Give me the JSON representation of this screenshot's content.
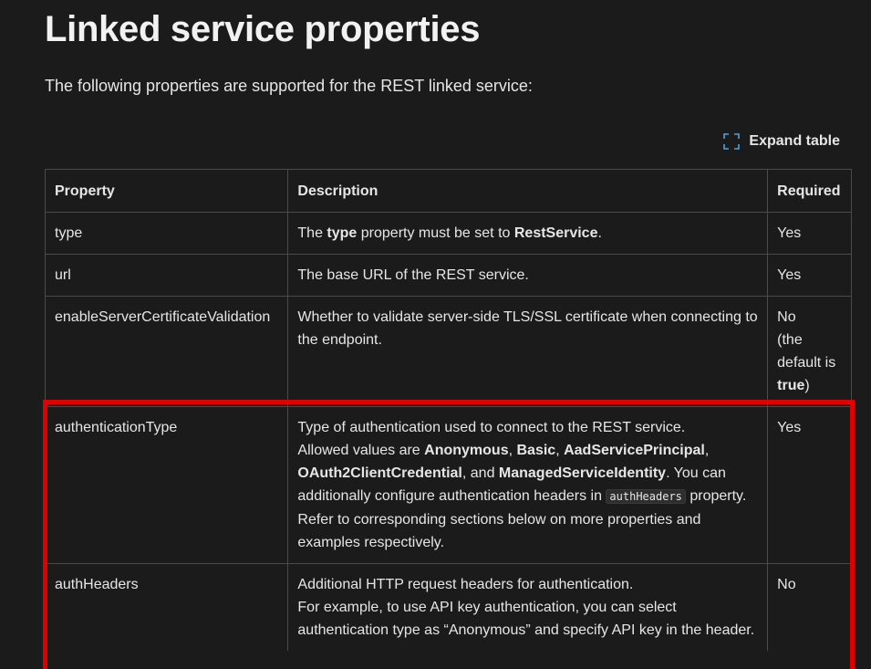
{
  "page": {
    "title": "Linked service properties",
    "intro": "The following properties are supported for the REST linked service:",
    "expand_label": "Expand table"
  },
  "table": {
    "headers": [
      "Property",
      "Description",
      "Required"
    ],
    "rows": [
      {
        "property": "type",
        "description": [
          {
            "t": "The "
          },
          {
            "t": "type",
            "b": true
          },
          {
            "t": " property must be set to "
          },
          {
            "t": "RestService",
            "b": true
          },
          {
            "t": "."
          }
        ],
        "required": [
          {
            "t": "Yes"
          }
        ]
      },
      {
        "property": "url",
        "description": [
          {
            "t": "The base URL of the REST service."
          }
        ],
        "required": [
          {
            "t": "Yes"
          }
        ]
      },
      {
        "property": "enableServerCertificateValidation",
        "description": [
          {
            "t": "Whether to validate server-side TLS/SSL certificate when connecting to the endpoint."
          }
        ],
        "required": [
          {
            "t": "No"
          },
          {
            "br": true
          },
          {
            "t": "(the default is "
          },
          {
            "t": "true",
            "b": true
          },
          {
            "t": ")"
          }
        ]
      },
      {
        "property": "authenticationType",
        "description": [
          {
            "t": "Type of authentication used to connect to the REST service."
          },
          {
            "br": true
          },
          {
            "t": "Allowed values are "
          },
          {
            "t": "Anonymous",
            "b": true
          },
          {
            "t": ", "
          },
          {
            "t": "Basic",
            "b": true
          },
          {
            "t": ", "
          },
          {
            "t": "AadServicePrincipal",
            "b": true
          },
          {
            "t": ", "
          },
          {
            "t": "OAuth2ClientCredential",
            "b": true
          },
          {
            "t": ", and "
          },
          {
            "t": "ManagedServiceIdentity",
            "b": true
          },
          {
            "t": ". You can additionally configure authentication headers in "
          },
          {
            "t": "authHeaders",
            "code": true
          },
          {
            "t": " property. Refer to corresponding sections below on more properties and examples respectively."
          }
        ],
        "required": [
          {
            "t": "Yes"
          }
        ]
      },
      {
        "property": "authHeaders",
        "description": [
          {
            "t": "Additional HTTP request headers for authentication."
          },
          {
            "br": true
          },
          {
            "t": "For example, to use API key authentication, you can select authentication type as “Anonymous” and specify API key in the header."
          }
        ],
        "required": [
          {
            "t": "No"
          }
        ]
      }
    ]
  },
  "highlight_color": "#e00000",
  "icons": {
    "expand": "expand-icon"
  }
}
